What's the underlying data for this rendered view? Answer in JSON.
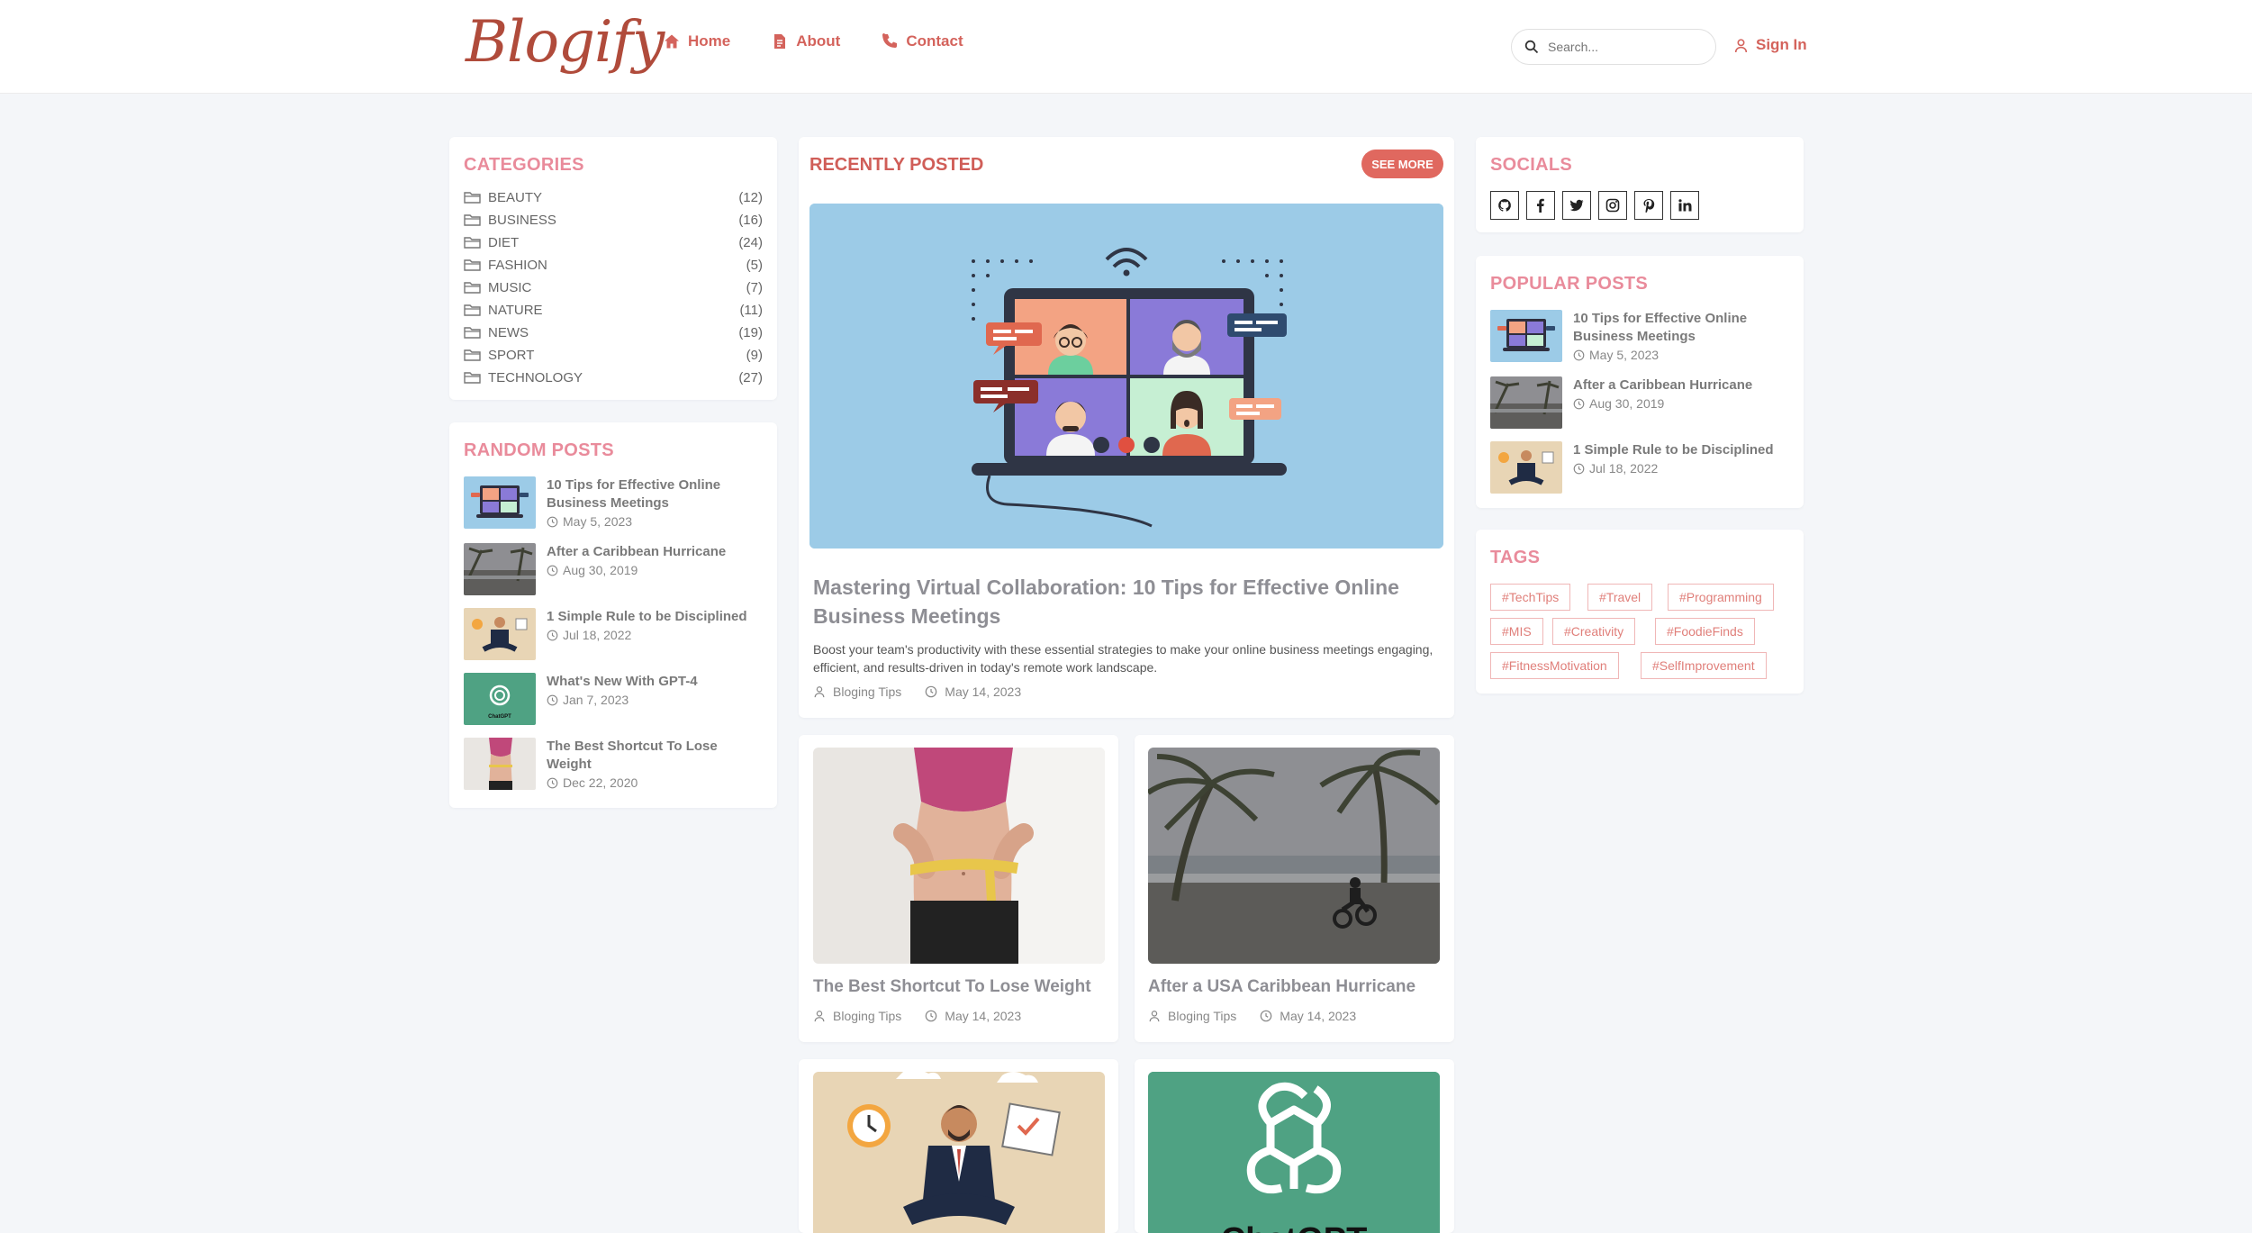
{
  "header": {
    "logo": "Blogify",
    "nav": [
      {
        "label": "Home",
        "icon": "home-icon"
      },
      {
        "label": "About",
        "icon": "document-icon"
      },
      {
        "label": "Contact",
        "icon": "phone-icon"
      }
    ],
    "search_placeholder": "Search...",
    "signin_label": "Sign In"
  },
  "categories": {
    "title": "CATEGORIES",
    "items": [
      {
        "name": "BEAUTY",
        "count": "(12)"
      },
      {
        "name": "BUSINESS",
        "count": "(16)"
      },
      {
        "name": "DIET",
        "count": "(24)"
      },
      {
        "name": "FASHION",
        "count": "(5)"
      },
      {
        "name": "MUSIC",
        "count": "(7)"
      },
      {
        "name": "NATURE",
        "count": "(11)"
      },
      {
        "name": "NEWS",
        "count": "(19)"
      },
      {
        "name": "SPORT",
        "count": "(9)"
      },
      {
        "name": "TECHNOLOGY",
        "count": "(27)"
      }
    ]
  },
  "random_posts": {
    "title": "RANDOM POSTS",
    "items": [
      {
        "title": "10 Tips for Effective Online Business Meetings",
        "date": "May 5, 2023"
      },
      {
        "title": "After a Caribbean Hurricane",
        "date": "Aug 30, 2019"
      },
      {
        "title": "1 Simple Rule to be Disciplined",
        "date": "Jul 18, 2022"
      },
      {
        "title": "What's New With GPT-4",
        "date": "Jan 7, 2023"
      },
      {
        "title": "The Best Shortcut To Lose Weight",
        "date": "Dec 22, 2020"
      }
    ]
  },
  "recent": {
    "title": "RECENTLY POSTED",
    "see_more": "SEE MORE",
    "hero": {
      "title": "Mastering Virtual Collaboration: 10 Tips for Effective Online Business Meetings",
      "excerpt": "Boost your team's productivity with these essential strategies to make your online business meetings engaging, efficient, and results-driven in today's remote work landscape.",
      "author": "Bloging Tips",
      "date": "May 14, 2023"
    },
    "grid": [
      {
        "title": "The Best Shortcut To Lose Weight",
        "author": "Bloging Tips",
        "date": "May 14, 2023"
      },
      {
        "title": "After a USA Caribbean Hurricane",
        "author": "Bloging Tips",
        "date": "May 14, 2023"
      }
    ],
    "chatgpt_label": "ChatGPT"
  },
  "socials": {
    "title": "SOCIALS",
    "icons": [
      "github-icon",
      "facebook-icon",
      "twitter-icon",
      "instagram-icon",
      "pinterest-icon",
      "linkedin-icon"
    ]
  },
  "popular_posts": {
    "title": "POPULAR POSTS",
    "items": [
      {
        "title": "10 Tips for Effective Online Business Meetings",
        "date": "May 5, 2023"
      },
      {
        "title": "After a Caribbean Hurricane",
        "date": "Aug 30, 2019"
      },
      {
        "title": "1 Simple Rule to be Disciplined",
        "date": "Jul 18, 2022"
      }
    ]
  },
  "tags": {
    "title": "TAGS",
    "items": [
      "#TechTips",
      "#Travel",
      "#Programming",
      "#MIS",
      "#Creativity",
      "#FoodieFinds",
      "#FitnessMotivation",
      "#SelfImprovement"
    ]
  },
  "colors": {
    "accent": "#e0685f",
    "heading_pink": "#e98b9b",
    "background": "#f4f6f9"
  }
}
